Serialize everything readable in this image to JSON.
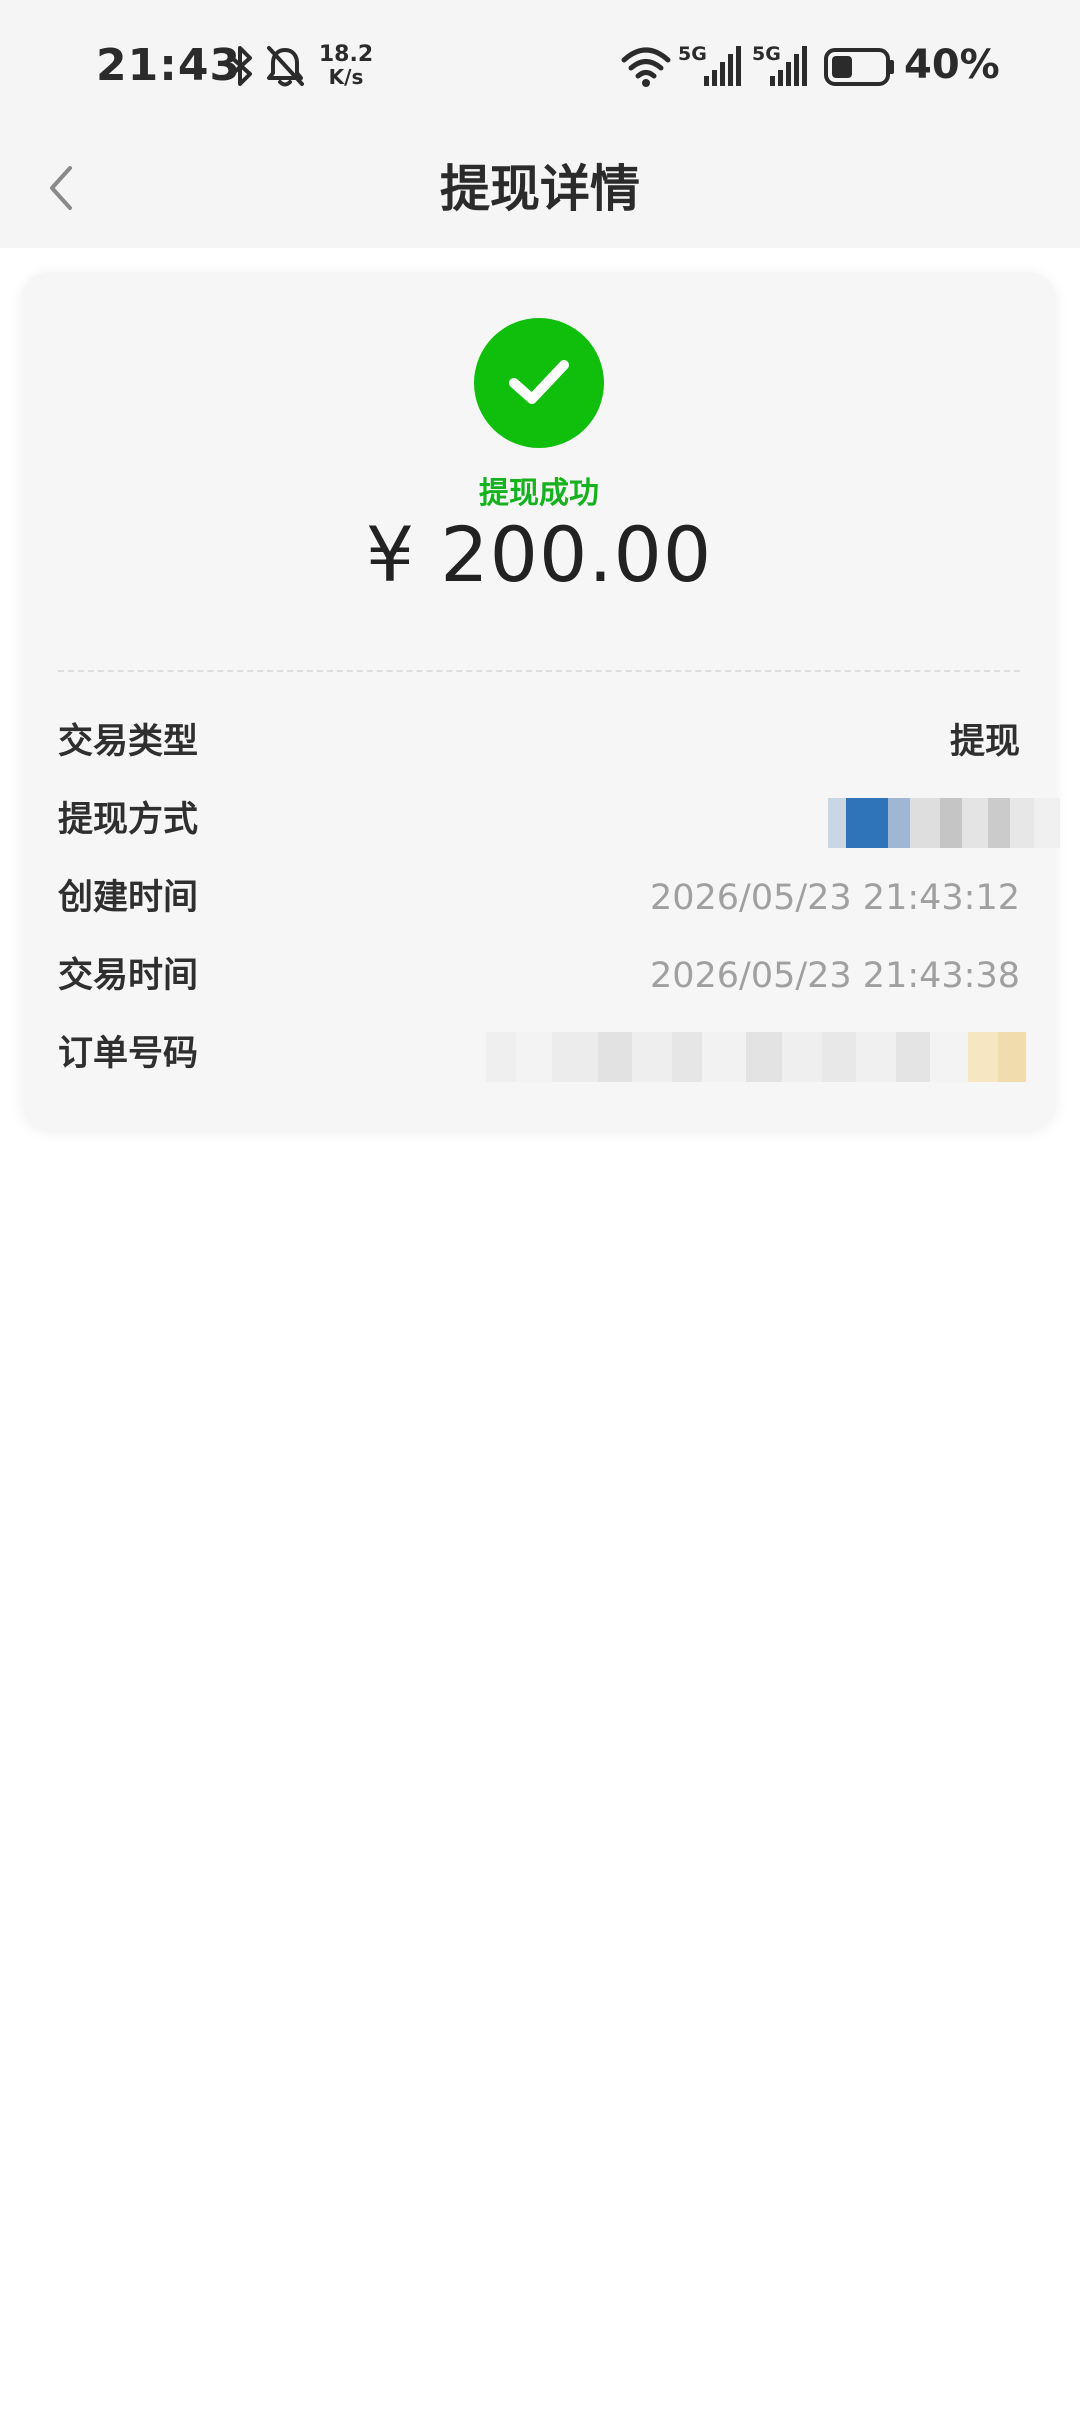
{
  "status_bar": {
    "time": "21:43",
    "net_speed_value": "18.2",
    "net_speed_unit": "K/s",
    "battery_percent": "40%",
    "battery_level": 0.4,
    "icons": [
      "bluetooth-icon",
      "bell-off-icon",
      "wifi-icon",
      "signal-5g-icon",
      "signal-5g-icon",
      "battery-icon"
    ]
  },
  "nav": {
    "title": "提现详情",
    "back_icon": "chevron-left-icon"
  },
  "result": {
    "status": "提现成功",
    "amount": "¥ 200.00",
    "icon": "check-icon"
  },
  "details": [
    {
      "label": "交易类型",
      "value": "提现"
    },
    {
      "label": "提现方式",
      "value": ""
    },
    {
      "label": "创建时间",
      "value": "2026/05/23 21:43:12"
    },
    {
      "label": "交易时间",
      "value": "2026/05/23 21:43:38"
    },
    {
      "label": "订单号码",
      "value": ""
    }
  ],
  "colors": {
    "success_green": "#0fbf0c",
    "status_text_green": "#14b21c",
    "background_gray": "#f5f5f5",
    "muted_text": "#a0a0a0"
  }
}
